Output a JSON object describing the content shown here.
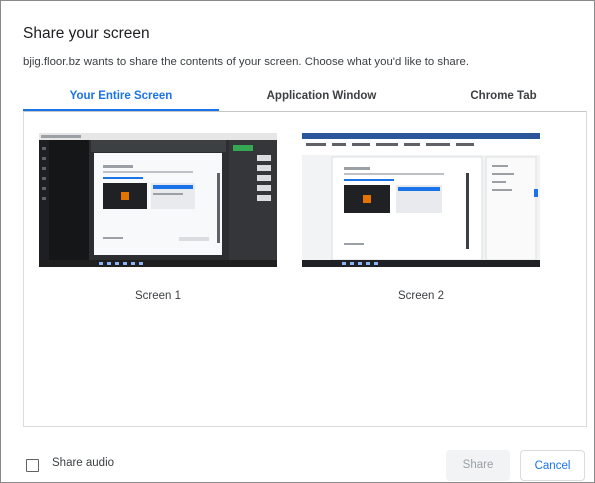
{
  "dialog": {
    "title": "Share your screen",
    "subtitle": "bjig.floor.bz wants to share the contents of your screen. Choose what you'd like to share."
  },
  "tabs": [
    {
      "label": "Your Entire Screen",
      "active": true
    },
    {
      "label": "Application Window",
      "active": false
    },
    {
      "label": "Chrome Tab",
      "active": false
    }
  ],
  "screens": [
    {
      "label": "Screen 1"
    },
    {
      "label": "Screen 2"
    }
  ],
  "footer": {
    "share_audio_label": "Share audio",
    "share_audio_checked": false,
    "share_button": "Share",
    "cancel_button": "Cancel"
  },
  "colors": {
    "accent": "#1a73e8",
    "disabled_text": "#9aa0a6"
  }
}
